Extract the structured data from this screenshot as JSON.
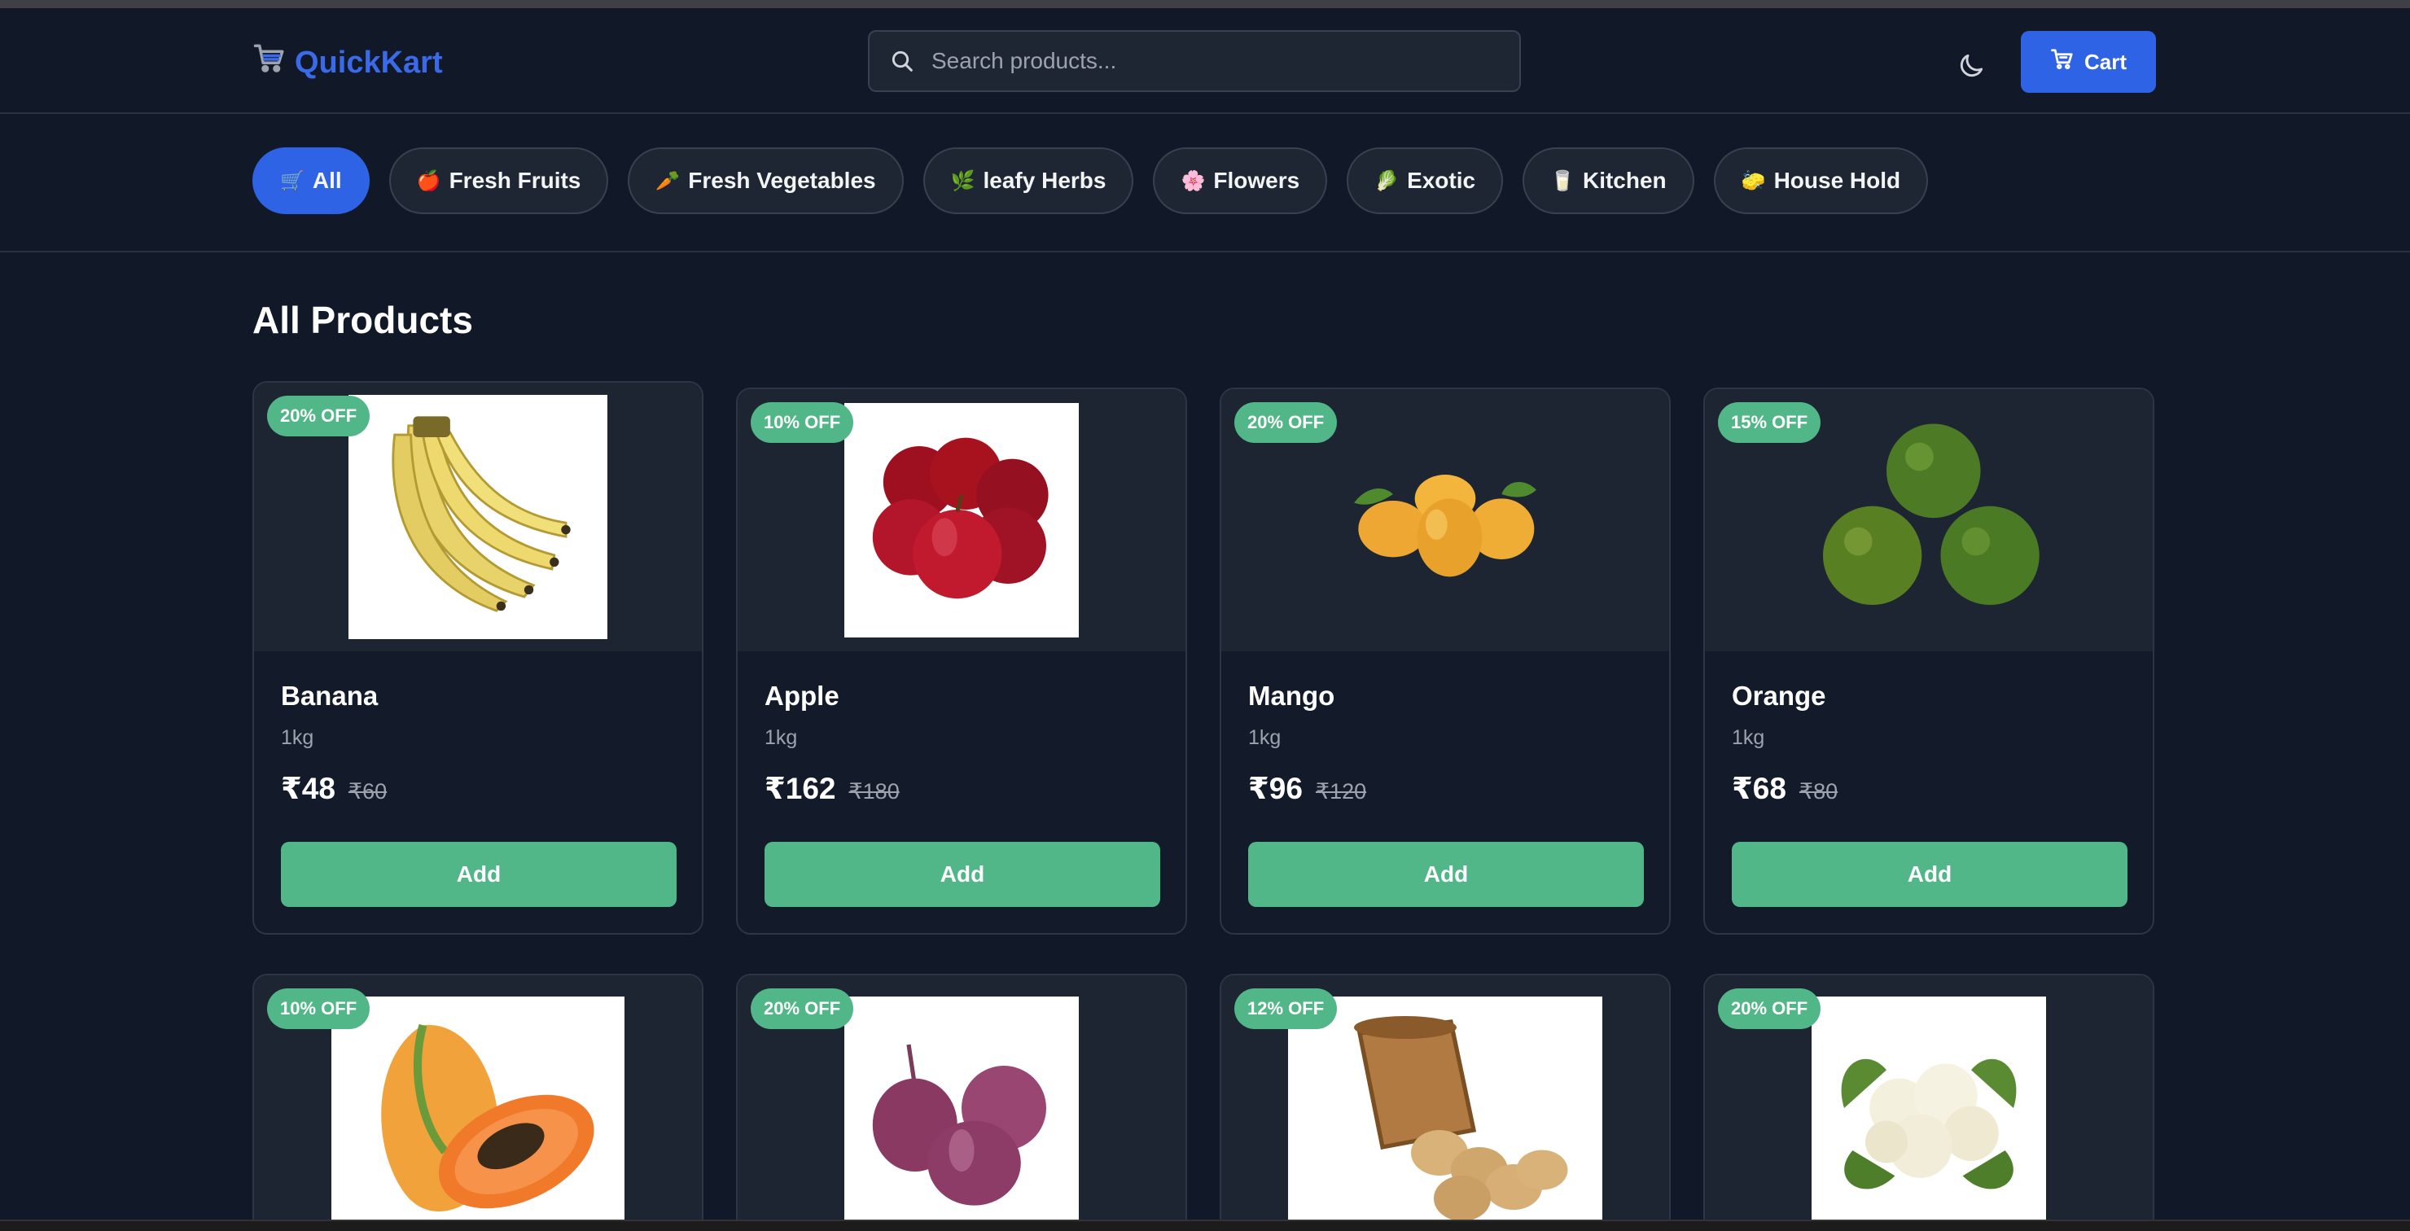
{
  "app": {
    "name": "QuickKart"
  },
  "search": {
    "placeholder": "Search products..."
  },
  "header": {
    "cart_label": "Cart"
  },
  "categories": [
    {
      "label": "All",
      "icon": "🛒"
    },
    {
      "label": "Fresh Fruits",
      "icon": "🍎"
    },
    {
      "label": "Fresh Vegetables",
      "icon": "🥕"
    },
    {
      "label": "leafy Herbs",
      "icon": "🌿"
    },
    {
      "label": "Flowers",
      "icon": "🌸"
    },
    {
      "label": "Exotic",
      "icon": "🥬"
    },
    {
      "label": "Kitchen",
      "icon": "🥛"
    },
    {
      "label": "House Hold",
      "icon": "🧽"
    }
  ],
  "section_title": "All Products",
  "products": [
    {
      "name": "Banana",
      "qty": "1kg",
      "price": "₹48",
      "mrp": "₹60",
      "discount": "20% OFF",
      "add_label": "Add",
      "image": "banana"
    },
    {
      "name": "Apple",
      "qty": "1kg",
      "price": "₹162",
      "mrp": "₹180",
      "discount": "10% OFF",
      "add_label": "Add",
      "image": "apple"
    },
    {
      "name": "Mango",
      "qty": "1kg",
      "price": "₹96",
      "mrp": "₹120",
      "discount": "20% OFF",
      "add_label": "Add",
      "image": "mango"
    },
    {
      "name": "Orange",
      "qty": "1kg",
      "price": "₹68",
      "mrp": "₹80",
      "discount": "15% OFF",
      "add_label": "Add",
      "image": "orange"
    },
    {
      "discount": "10% OFF",
      "image": "papaya"
    },
    {
      "discount": "20% OFF",
      "image": "onion"
    },
    {
      "discount": "12% OFF",
      "image": "potato"
    },
    {
      "discount": "20% OFF",
      "image": "cauliflower"
    }
  ],
  "colors": {
    "accent": "#2f63e6",
    "success": "#52b788",
    "background": "#111827"
  }
}
